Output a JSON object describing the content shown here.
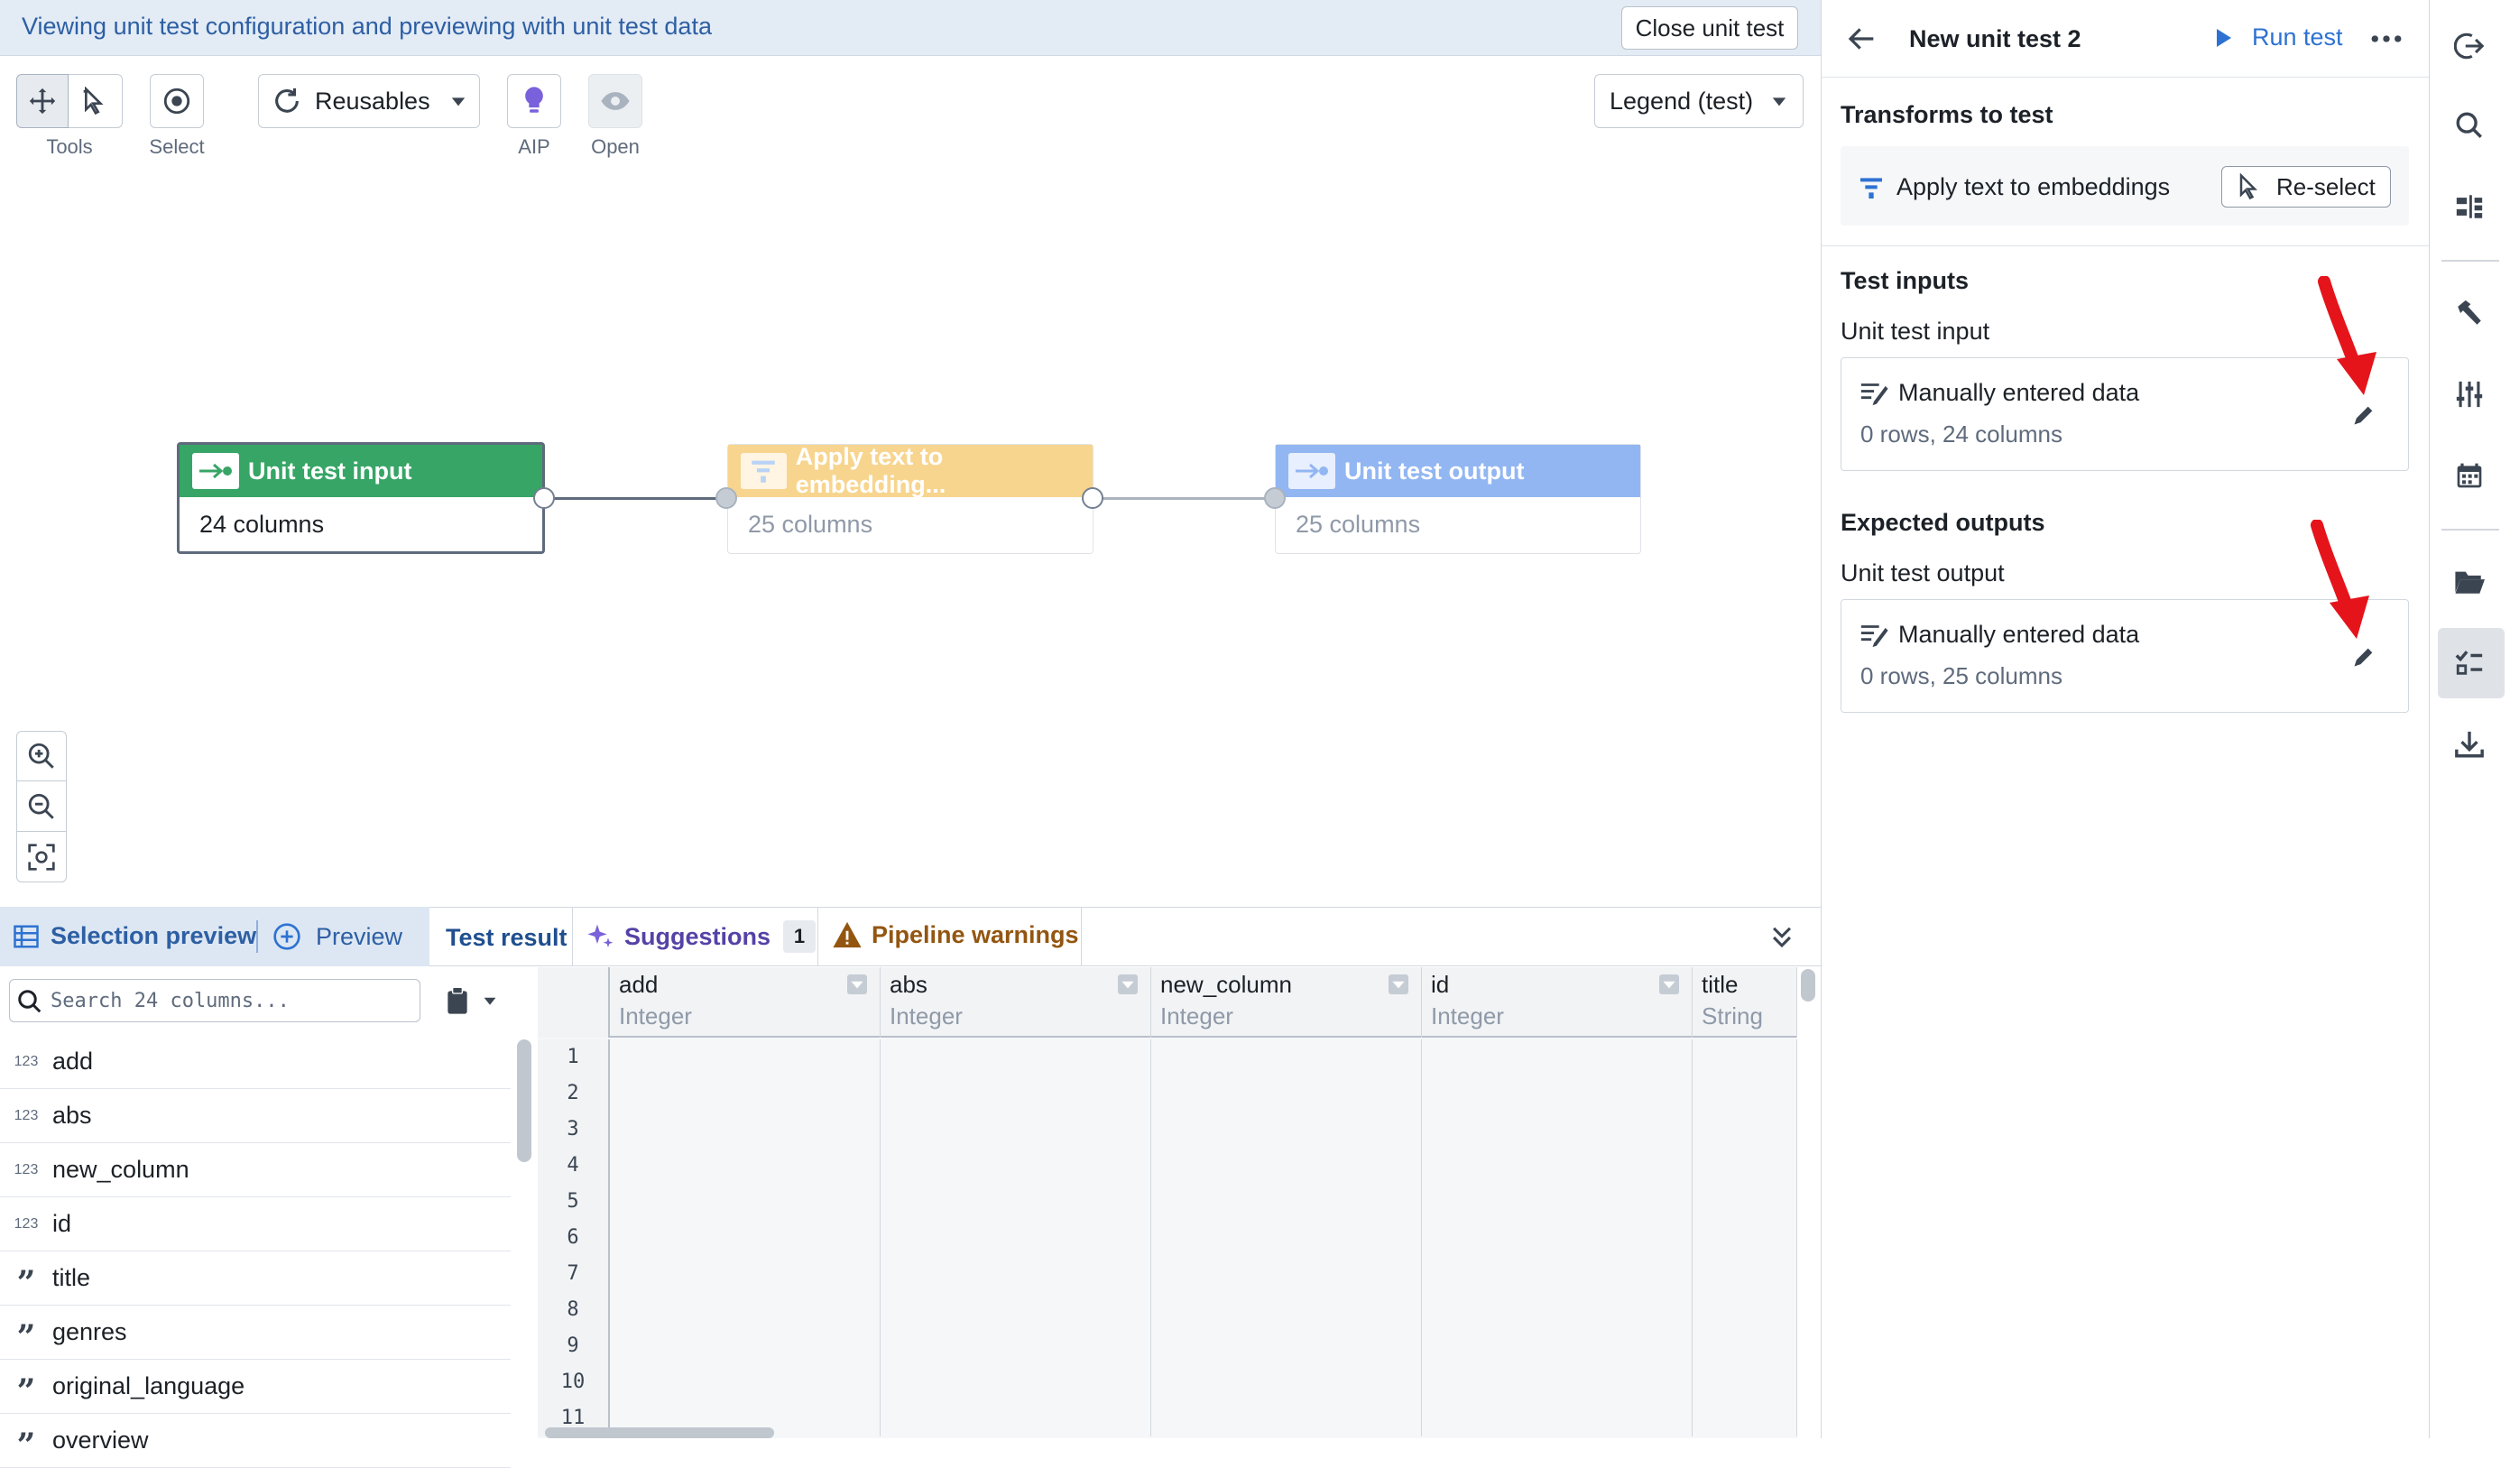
{
  "banner": {
    "text": "Viewing unit test configuration and previewing with unit test data",
    "close_button": "Close unit test"
  },
  "toolbar": {
    "tools_label": "Tools",
    "select_label": "Select",
    "reusables_label": "Reusables",
    "aip_label": "AIP",
    "open_label": "Open",
    "legend_label": "Legend (test)"
  },
  "graph": {
    "nodes": [
      {
        "title": "Unit test input",
        "subtitle": "24 columns",
        "color": "#36a566"
      },
      {
        "title": "Apply text to embedding...",
        "subtitle": "25 columns",
        "color": "#f7d58f"
      },
      {
        "title": "Unit test output",
        "subtitle": "25 columns",
        "color": "#92b6f2"
      }
    ]
  },
  "bottom": {
    "tabs": {
      "selection_preview": "Selection preview",
      "preview": "Preview",
      "test_result": "Test result",
      "suggestions": "Suggestions",
      "suggestions_count": "1",
      "pipeline_warnings": "Pipeline warnings"
    },
    "search_placeholder": "Search 24 columns...",
    "columns": [
      {
        "type": "123",
        "name": "add"
      },
      {
        "type": "123",
        "name": "abs"
      },
      {
        "type": "123",
        "name": "new_column"
      },
      {
        "type": "123",
        "name": "id"
      },
      {
        "type": "”",
        "name": "title"
      },
      {
        "type": "”",
        "name": "genres"
      },
      {
        "type": "”",
        "name": "original_language"
      },
      {
        "type": "”",
        "name": "overview"
      }
    ],
    "grid": {
      "headers": [
        {
          "name": "add",
          "type": "Integer"
        },
        {
          "name": "abs",
          "type": "Integer"
        },
        {
          "name": "new_column",
          "type": "Integer"
        },
        {
          "name": "id",
          "type": "Integer"
        },
        {
          "name": "title",
          "type": "String"
        }
      ],
      "row_numbers": [
        "1",
        "2",
        "3",
        "4",
        "5",
        "6",
        "7",
        "8",
        "9",
        "10",
        "11"
      ]
    }
  },
  "right_panel": {
    "title": "New unit test 2",
    "run_test": "Run test",
    "transforms_heading": "Transforms to test",
    "transform_name": "Apply text to embeddings",
    "reselect": "Re-select",
    "test_inputs_heading": "Test inputs",
    "input_label": "Unit test input",
    "input_card_title": "Manually entered data",
    "input_card_sub": "0 rows, 24 columns",
    "expected_outputs_heading": "Expected outputs",
    "output_label": "Unit test output",
    "output_card_title": "Manually entered data",
    "output_card_sub": "0 rows, 25 columns"
  },
  "colors": {
    "accent": "#2d72d2",
    "annotation_arrow": "#e5141b",
    "input_green": "#36a566",
    "transform_yellow": "#f7d58f",
    "output_blue": "#92b6f2",
    "warning": "#935610"
  }
}
